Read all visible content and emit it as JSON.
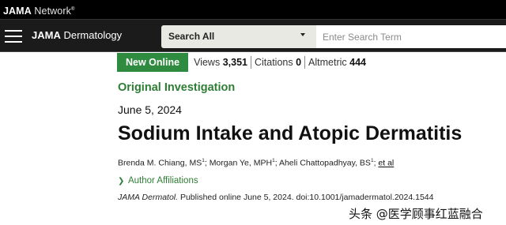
{
  "network": {
    "jama": "JAMA",
    "network": "Network",
    "tm": "®"
  },
  "nav": {
    "journal_prefix": "JAMA",
    "journal_suffix": "Dermatology",
    "search_scope": "Search All",
    "search_placeholder": "Enter Search Term"
  },
  "metrics": {
    "badge": "New Online",
    "items": [
      {
        "label": "Views",
        "value": "3,351"
      },
      {
        "label": "Citations",
        "value": "0"
      },
      {
        "label": "Altmetric",
        "value": "444"
      }
    ]
  },
  "article": {
    "type": "Original Investigation",
    "date": "June 5, 2024",
    "title": "Sodium Intake and Atopic Dermatitis",
    "authors": [
      {
        "name": "Brenda M. Chiang, MS",
        "sup": "1"
      },
      {
        "name": "Morgan Ye, MPH",
        "sup": "1"
      },
      {
        "name": "Aheli Chattopadhyay, BS",
        "sup": "1"
      }
    ],
    "et_al": "et al",
    "affiliations_label": "Author Affiliations",
    "citation_journal": "JAMA Dermatol.",
    "citation_rest": "Published online June 5, 2024. doi:10.1001/jamadermatol.2024.1544"
  },
  "watermark": "头条 @医学顾事红蓝融合"
}
